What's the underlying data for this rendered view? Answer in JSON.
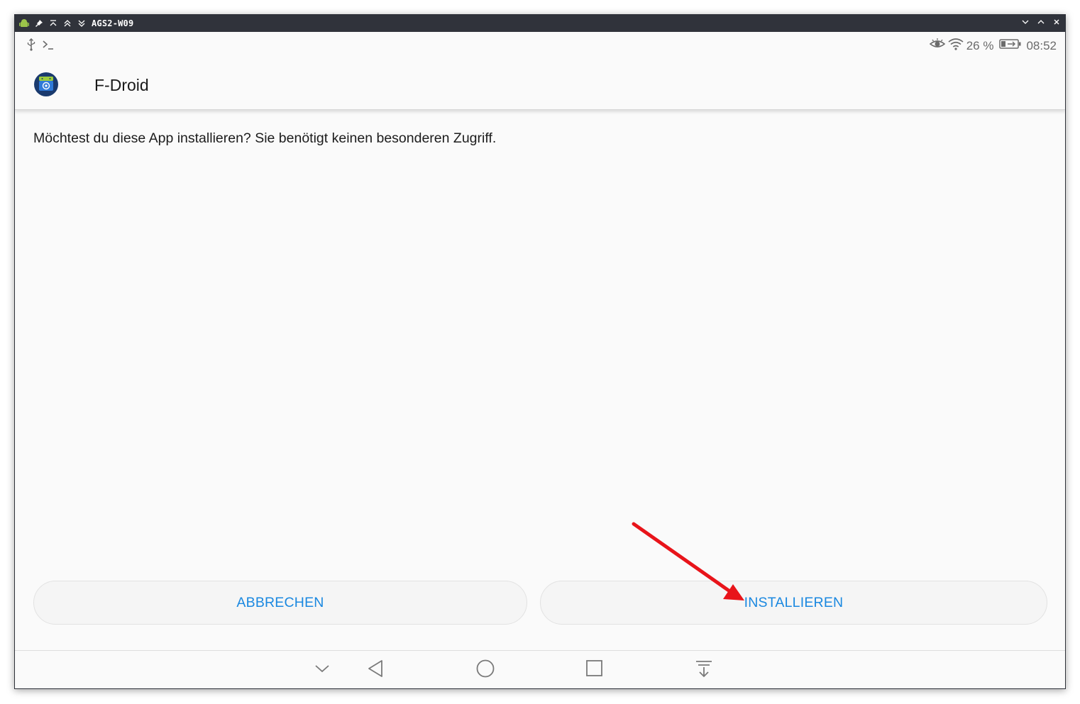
{
  "window": {
    "title": "AGS2-W09"
  },
  "status_bar": {
    "battery_text": "26 %",
    "time": "08:52",
    "icons": [
      "usb-icon",
      "terminal-icon",
      "eye-comfort-icon",
      "wifi-icon",
      "battery-charging-icon"
    ]
  },
  "app_bar": {
    "title": "F-Droid",
    "icon": "f-droid-logo"
  },
  "dialog": {
    "message": "Möchtest du diese App installieren? Sie benötigt keinen besonderen Zugriff.",
    "cancel_label": "ABBRECHEN",
    "install_label": "INSTALLIEREN"
  },
  "nav_bar": {
    "icons": [
      "hide-nav-icon",
      "back-icon",
      "home-icon",
      "recents-icon",
      "notification-pull-icon"
    ]
  },
  "colors": {
    "accent": "#1a88e0",
    "annotation_arrow": "#e8141a",
    "titlebar": "#30333b"
  }
}
